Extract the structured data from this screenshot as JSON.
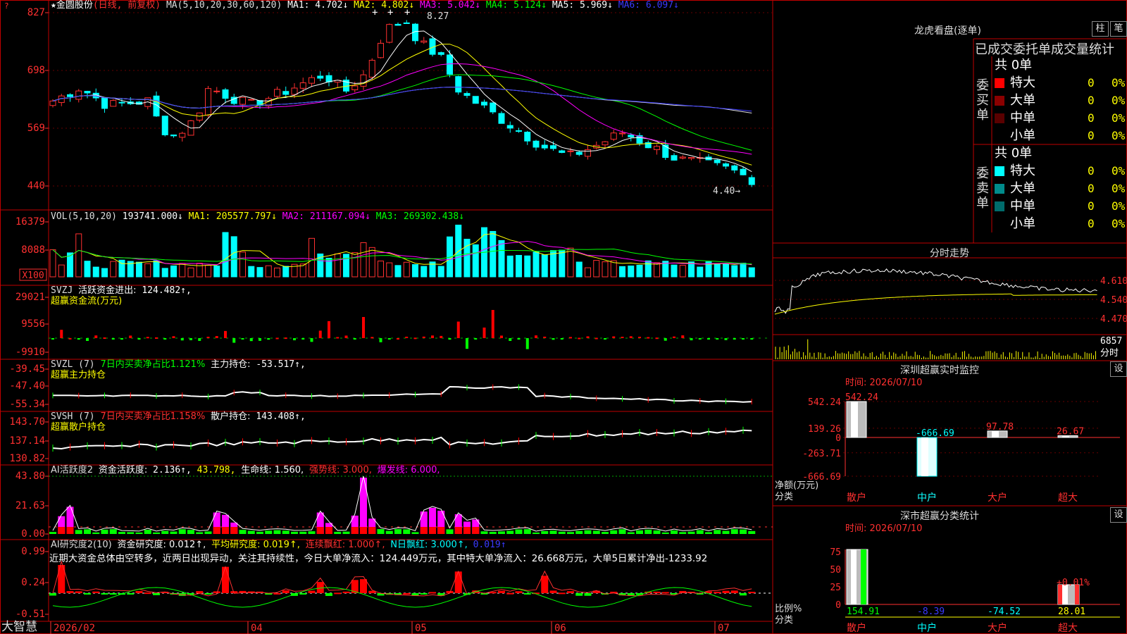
{
  "app": {
    "brand": "大智慧"
  },
  "main_header": {
    "symbol": "★金圆股份",
    "mode": "(日线, 前复权)",
    "ma_params": "MA(5,10,20,30,60,120)",
    "items": [
      {
        "label": "MA1:",
        "value": "4.702↓",
        "color": "#ffffff"
      },
      {
        "label": "MA2:",
        "value": "4.802↓",
        "color": "#ffff00"
      },
      {
        "label": "MA3:",
        "value": "5.042↓",
        "color": "#ff00ff"
      },
      {
        "label": "MA4:",
        "value": "5.124↓",
        "color": "#00ff00"
      },
      {
        "label": "MA5:",
        "value": "5.969↓",
        "color": "#ffffff"
      },
      {
        "label": "MA6:",
        "value": "6.097↓",
        "color": "#3a3aff"
      }
    ],
    "high_mark": "8.27",
    "low_mark": "4.40→",
    "axis": [
      "827",
      "698",
      "569",
      "440"
    ]
  },
  "vol_header": {
    "name": "VOL(5,10,20)",
    "value": "193741.000↓",
    "items": [
      {
        "label": "MA1:",
        "value": "205577.797↓",
        "color": "#ffff00"
      },
      {
        "label": "MA2:",
        "value": "211167.094↓",
        "color": "#ff00ff"
      },
      {
        "label": "MA3:",
        "value": "269302.438↓",
        "color": "#00ff00"
      }
    ],
    "axis": [
      "16379",
      "8088",
      "X100"
    ]
  },
  "svzj": {
    "name": "SVZJ",
    "label": "活跃资金进出:",
    "value": "124.482↑,",
    "sub": "超赢资金流(万元)",
    "axis": [
      "29021",
      "9556",
      "-9910"
    ]
  },
  "svzl": {
    "name": "SVZL (7)",
    "net": "7日内买卖净占比1.121%",
    "label": "主力持仓:",
    "value": "-53.517↑,",
    "sub": "超赢主力持仓",
    "axis": [
      "-39.45",
      "-47.40",
      "-55.34"
    ]
  },
  "svsh": {
    "name": "SVSH (7)",
    "net": "7日内买卖净占比1.158%",
    "label": "散户持仓:",
    "value": "143.408↑,",
    "sub": "超赢散户持仓",
    "axis": [
      "143.70",
      "137.14",
      "130.82"
    ]
  },
  "ai_act": {
    "name": "AI活跃度2",
    "label": "资金活跃度:",
    "value": "2.136↑,",
    "v2": "43.798,",
    "life": "生命线: 1.560,",
    "strong": "强势线: 3.000,",
    "burst": "爆发线: 6.000,",
    "axis": [
      "43.80",
      "21.63",
      "0.00"
    ]
  },
  "ai_res": {
    "name": "AI研究度2(10)",
    "l1": "资金研究度: 0.012↑,",
    "l2": "平均研究度: 0.019↑,",
    "l3": "连续飘红: 1.000↑,",
    "l4": "N日飘红: 3.000↑,",
    "l5": "0.019↑",
    "comment": "近期大资金总体由空转多，近两日出现异动，关注其持续性，今日大单净流入：124.449万元，其中特大单净流入：26.668万元，大单5日累计净出-1233.92",
    "axis": [
      "0.99",
      "0.24",
      "-0.51"
    ]
  },
  "x_axis": [
    "2026/02",
    "04",
    "05",
    "06",
    "07"
  ],
  "dragon": {
    "title": "龙虎看盘(逐单)",
    "btn1": "柱",
    "btn2": "笔",
    "stats_title": "已成交委托单成交量统计",
    "buy": {
      "label": "委买单",
      "total": "共 0单",
      "rows": [
        {
          "name": "特大",
          "v": "0",
          "p": "0%",
          "color": "#ff0000"
        },
        {
          "name": "大单",
          "v": "0",
          "p": "0%",
          "color": "#8b0000"
        },
        {
          "name": "中单",
          "v": "0",
          "p": "0%",
          "color": "#5a0000"
        },
        {
          "name": "小单",
          "v": "0",
          "p": "0%",
          "color": "#000000"
        }
      ]
    },
    "sell": {
      "label": "委卖单",
      "total": "共 0单",
      "rows": [
        {
          "name": "特大",
          "v": "0",
          "p": "0%",
          "color": "#00ffff"
        },
        {
          "name": "大单",
          "v": "0",
          "p": "0%",
          "color": "#008b8b"
        },
        {
          "name": "中单",
          "v": "0",
          "p": "0%",
          "color": "#006b6b"
        },
        {
          "name": "小单",
          "v": "0",
          "p": "0%",
          "color": "#000000"
        }
      ]
    }
  },
  "intraday": {
    "title": "分时走势",
    "axis": [
      "4.610",
      "4.540",
      "4.470"
    ],
    "vol": "6857",
    "vol_label": "分时"
  },
  "sz_monitor": {
    "title": "深圳超赢实时监控",
    "btn": "设",
    "time": "时间: 2026/07/10",
    "axis": [
      "542.24",
      "139.26",
      "0",
      "-263.71",
      "-666.69"
    ],
    "ylabel": "净额(万元)",
    "xlabel": "分类",
    "bars": [
      {
        "name": "散户",
        "value": 542.24,
        "label": "542.24"
      },
      {
        "name": "中户",
        "value": -666.69,
        "label": "-666.69"
      },
      {
        "name": "大户",
        "value": 97.78,
        "label": "97.78"
      },
      {
        "name": "超大",
        "value": 26.67,
        "label": "26.67"
      }
    ]
  },
  "sz_class": {
    "title": "深市超赢分类统计",
    "btn": "设",
    "time": "时间: 2026/07/10",
    "axis": [
      "75",
      "50",
      "25",
      "0"
    ],
    "ylabel": "比例%",
    "xlabel": "分类",
    "bars": [
      {
        "name": "散户",
        "value": 154.91,
        "label": "154.91"
      },
      {
        "name": "中户",
        "value": -8.39,
        "label": "-8.39"
      },
      {
        "name": "大户",
        "value": -74.52,
        "label": "-74.52"
      },
      {
        "name": "超大",
        "value": 28.01,
        "label": "28.01"
      }
    ],
    "annotation": "+0.01%"
  },
  "chart_data": [
    {
      "type": "bar",
      "title": "深圳超赢实时监控",
      "ylabel": "净额(万元)",
      "xlabel": "分类",
      "categories": [
        "散户",
        "中户",
        "大户",
        "超大"
      ],
      "values": [
        542.24,
        -666.69,
        97.78,
        26.67
      ],
      "ylim": [
        -666.69,
        542.24
      ]
    },
    {
      "type": "bar",
      "title": "深市超赢分类统计",
      "ylabel": "比例%",
      "xlabel": "分类",
      "categories": [
        "散户",
        "中户",
        "大户",
        "超大"
      ],
      "values": [
        154.91,
        -8.39,
        -74.52,
        28.01
      ],
      "ylim": [
        0,
        75
      ]
    }
  ]
}
